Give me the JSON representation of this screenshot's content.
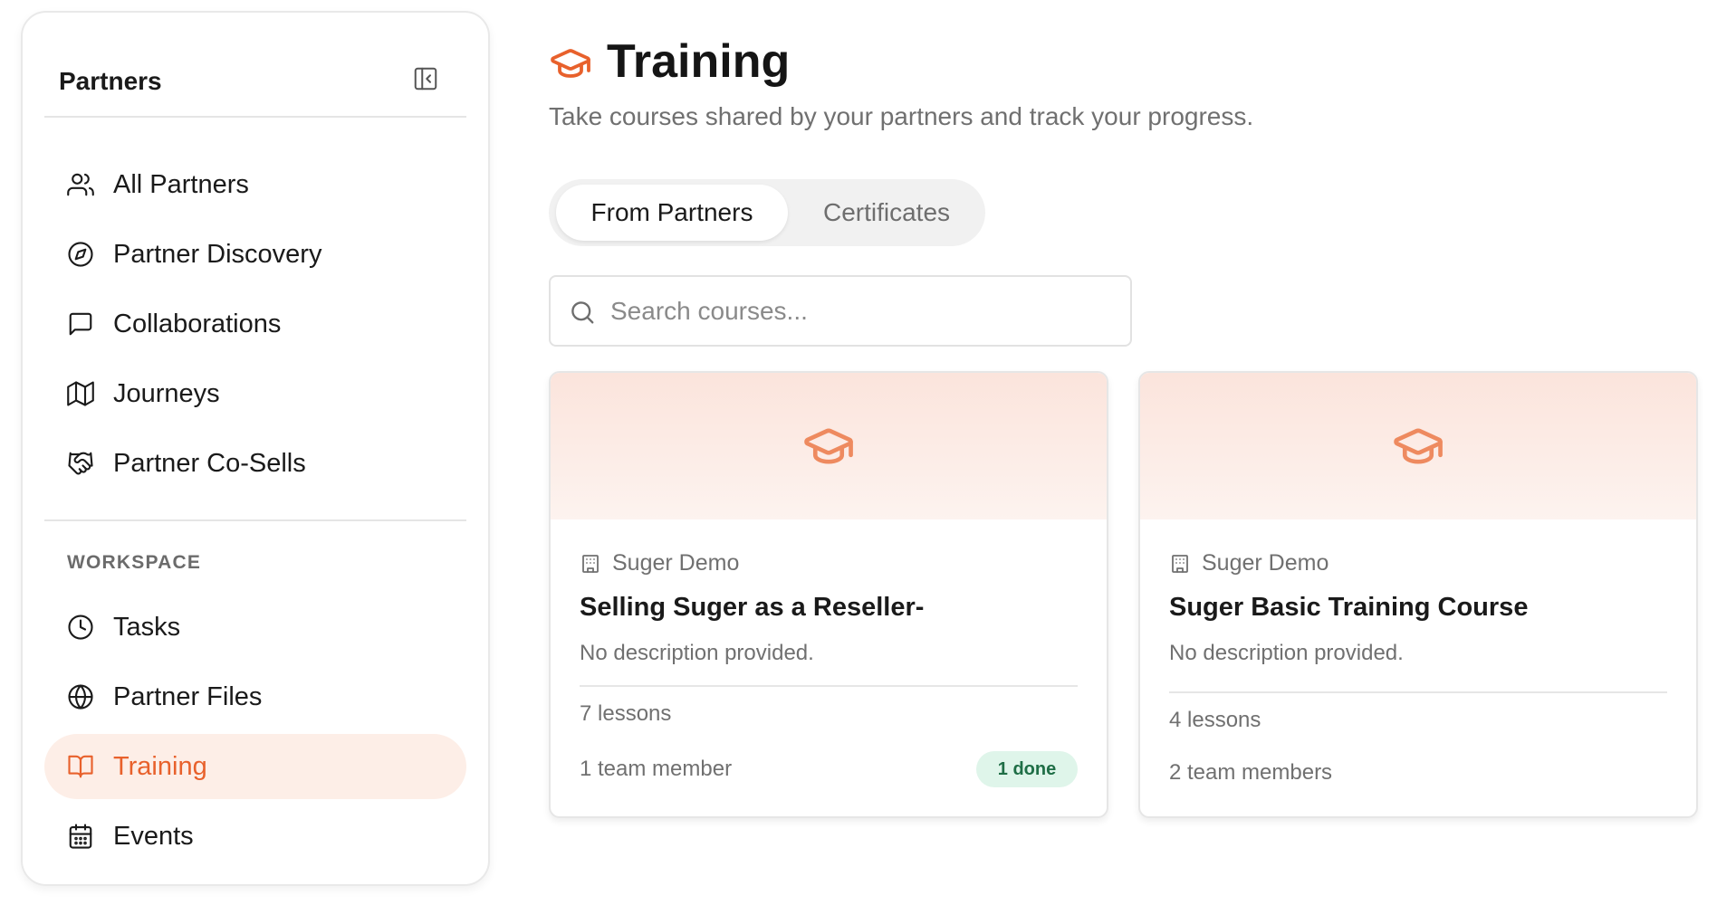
{
  "sidebar": {
    "title": "Partners",
    "collapse_icon": "sidebar-collapse-icon",
    "items": [
      {
        "label": "All Partners",
        "icon": "users-icon"
      },
      {
        "label": "Partner Discovery",
        "icon": "compass-icon"
      },
      {
        "label": "Collaborations",
        "icon": "message-square-icon"
      },
      {
        "label": "Journeys",
        "icon": "map-icon"
      },
      {
        "label": "Partner Co-Sells",
        "icon": "handshake-icon"
      }
    ],
    "workspace_section": "WORKSPACE",
    "workspace_items": [
      {
        "label": "Tasks",
        "icon": "clock-icon"
      },
      {
        "label": "Partner Files",
        "icon": "globe-icon"
      },
      {
        "label": "Training",
        "icon": "book-open-icon",
        "active": true
      },
      {
        "label": "Events",
        "icon": "calendar-icon"
      }
    ]
  },
  "header": {
    "icon": "graduation-cap-icon",
    "title": "Training",
    "subtitle": "Take courses shared by your partners and track your progress."
  },
  "tabs": [
    {
      "label": "From Partners",
      "active": true
    },
    {
      "label": "Certificates",
      "active": false
    }
  ],
  "search": {
    "placeholder": "Search courses...",
    "value": ""
  },
  "courses": [
    {
      "org": "Suger Demo",
      "title": "Selling Suger as a Reseller-",
      "description": "No description provided.",
      "lessons": "7 lessons",
      "members": "1 team member",
      "badge": "1 done"
    },
    {
      "org": "Suger Demo",
      "title": "Suger Basic Training Course",
      "description": "No description provided.",
      "lessons": "4 lessons",
      "members": "2 team members"
    }
  ],
  "colors": {
    "accent": "#e8612c",
    "active_nav_bg": "#fdeee7",
    "badge_bg": "#dff5ea",
    "badge_text": "#1f6e46"
  }
}
